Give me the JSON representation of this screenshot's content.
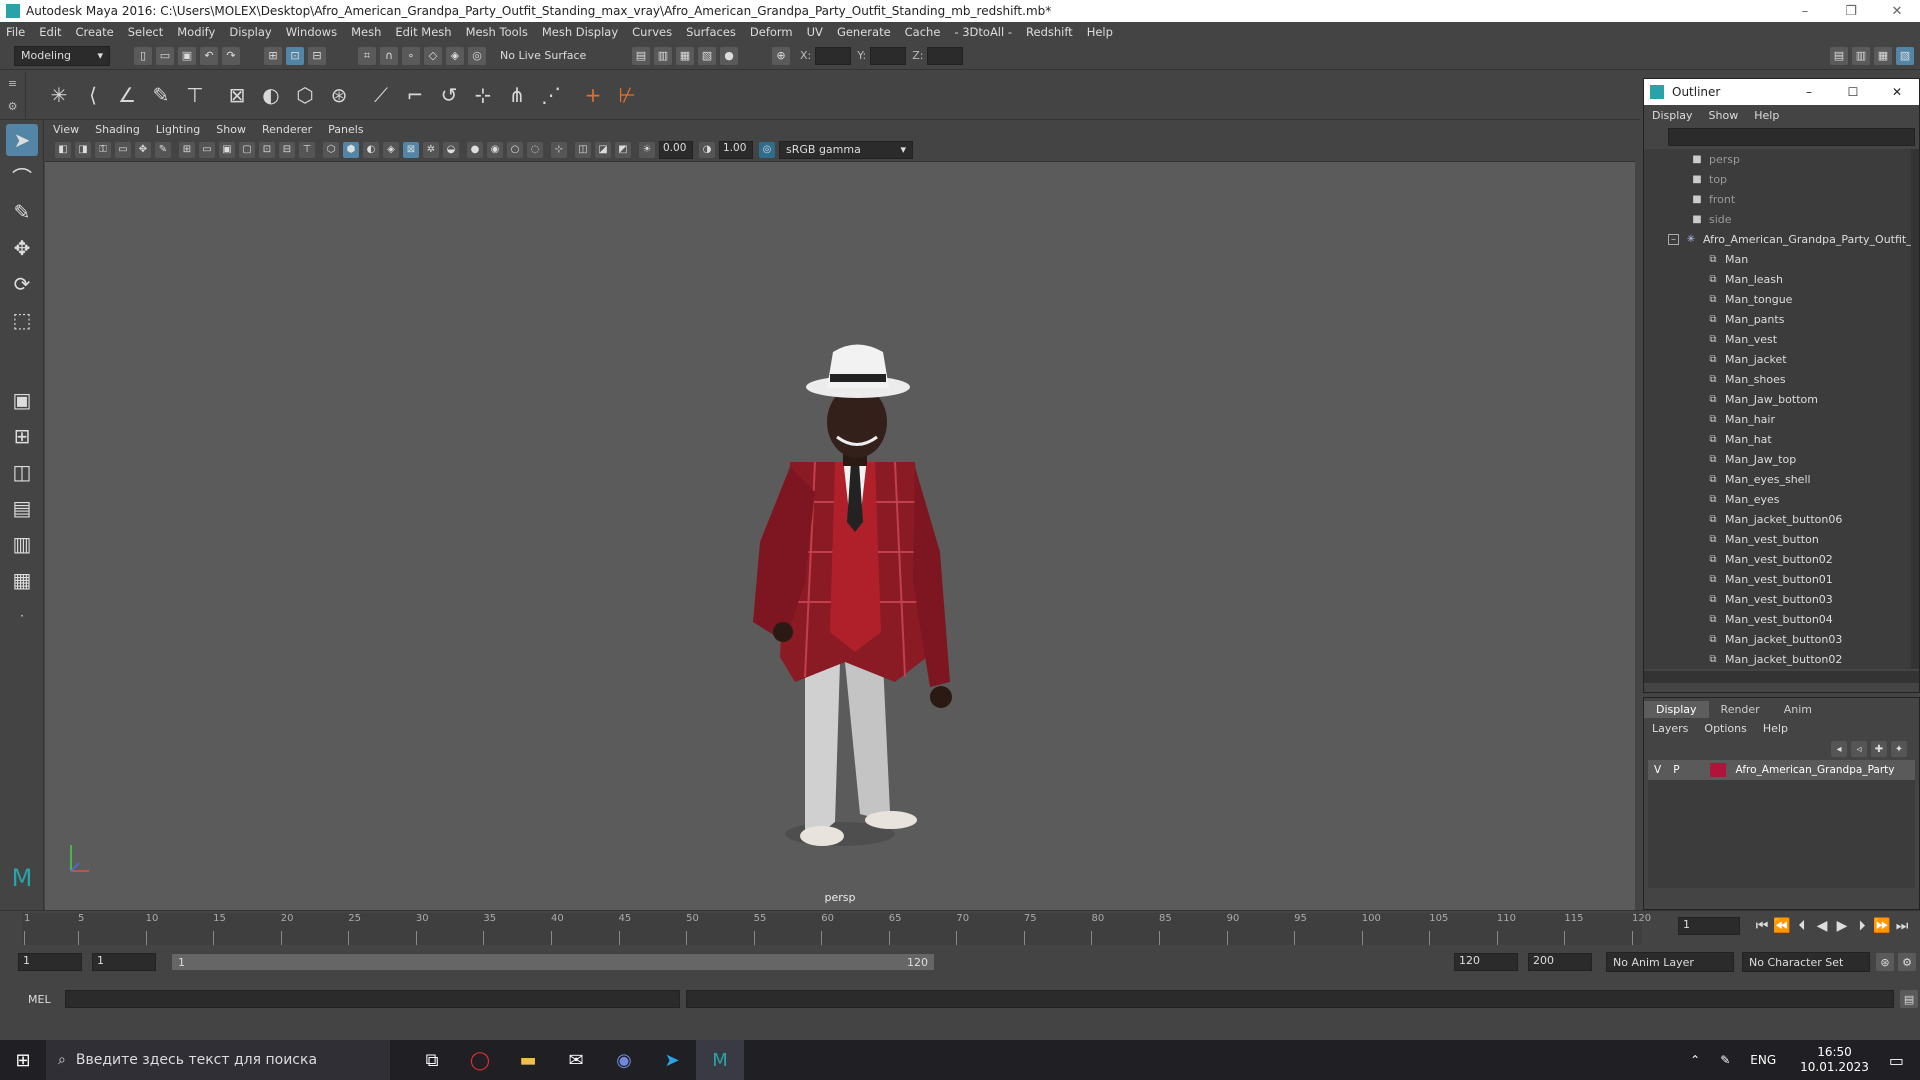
{
  "window": {
    "title": "Autodesk Maya 2016: C:\\Users\\MOLEX\\Desktop\\Afro_American_Grandpa_Party_Outfit_Standing_max_vray\\Afro_American_Grandpa_Party_Outfit_Standing_mb_redshift.mb*",
    "min": "–",
    "max": "❐",
    "close": "✕"
  },
  "menubar": [
    "File",
    "Edit",
    "Create",
    "Select",
    "Modify",
    "Display",
    "Windows",
    "Mesh",
    "Edit Mesh",
    "Mesh Tools",
    "Mesh Display",
    "Curves",
    "Surfaces",
    "Deform",
    "UV",
    "Generate",
    "Cache",
    "- 3DtoAll -",
    "Redshift",
    "Help"
  ],
  "status": {
    "mode": "Modeling",
    "live_surface": "No Live Surface",
    "x_label": "X:",
    "y_label": "Y:",
    "z_label": "Z:"
  },
  "viewport": {
    "menu": [
      "View",
      "Shading",
      "Lighting",
      "Show",
      "Renderer",
      "Panels"
    ],
    "exposure": "0.00",
    "gamma": "1.00",
    "color_space": "sRGB gamma",
    "camera_label": "persp"
  },
  "outliner": {
    "title": "Outliner",
    "menu": [
      "Display",
      "Show",
      "Help"
    ],
    "cameras": [
      "persp",
      "top",
      "front",
      "side"
    ],
    "group": "Afro_American_Grandpa_Party_Outfit_S",
    "children": [
      "Man",
      "Man_leash",
      "Man_tongue",
      "Man_pants",
      "Man_vest",
      "Man_jacket",
      "Man_shoes",
      "Man_Jaw_bottom",
      "Man_hair",
      "Man_hat",
      "Man_Jaw_top",
      "Man_eyes_shell",
      "Man_eyes",
      "Man_jacket_button06",
      "Man_vest_button",
      "Man_vest_button02",
      "Man_vest_button01",
      "Man_vest_button03",
      "Man_vest_button04",
      "Man_jacket_button03",
      "Man_jacket_button02"
    ]
  },
  "layers": {
    "tabs": [
      "Display",
      "Render",
      "Anim"
    ],
    "menu": [
      "Layers",
      "Options",
      "Help"
    ],
    "layer": {
      "v": "V",
      "p": "P",
      "name": "Afro_American_Grandpa_Party",
      "color": "#b0143a"
    }
  },
  "timeline": {
    "ticks": [
      1,
      5,
      10,
      15,
      20,
      25,
      30,
      35,
      40,
      45,
      50,
      55,
      60,
      65,
      70,
      75,
      80,
      85,
      90,
      95,
      100,
      105,
      110,
      115,
      120
    ],
    "current_frame": "1"
  },
  "range": {
    "start": "1",
    "inner_start": "1",
    "slider_start": "1",
    "slider_end": "120",
    "end": "120",
    "outer_end": "200",
    "anim_layer": "No Anim Layer",
    "char_set": "No Character Set"
  },
  "cmdline": {
    "label": "MEL"
  },
  "taskbar": {
    "search_placeholder": "Введите здесь текст для поиска",
    "lang": "ENG",
    "time": "16:50",
    "date": "10.01.2023"
  }
}
